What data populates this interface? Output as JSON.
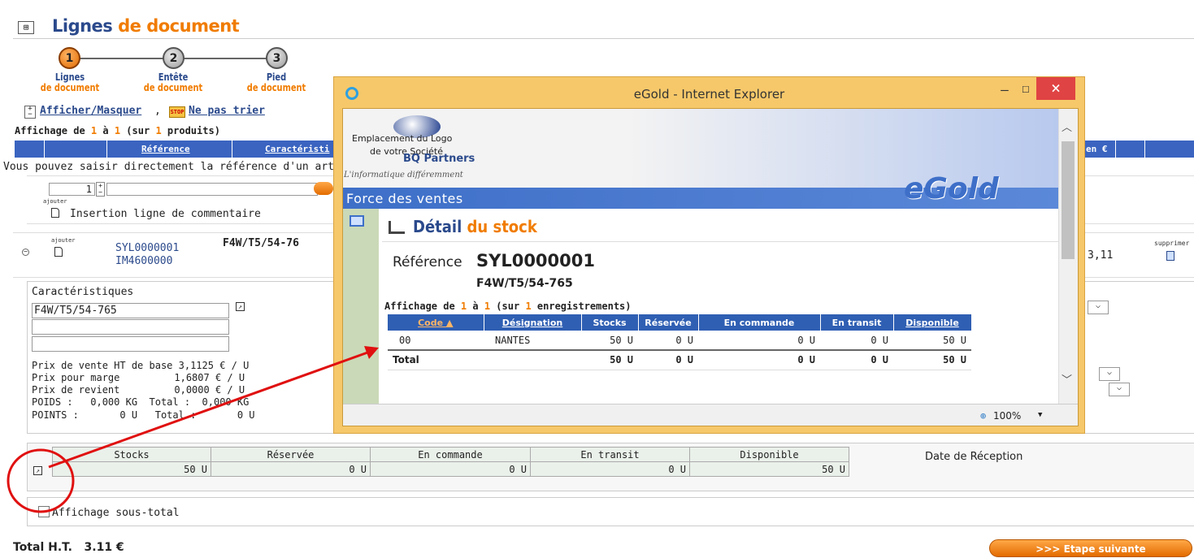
{
  "page": {
    "title_part1": "Lignes",
    "title_part2": "de document",
    "steps": [
      {
        "num": "1",
        "line1": "Lignes",
        "line2": "de document"
      },
      {
        "num": "2",
        "line1": "Entête",
        "line2": "de document"
      },
      {
        "num": "3",
        "line1": "Pied",
        "line2": "de document"
      }
    ],
    "toggle_link": "Afficher/Masquer",
    "comma": ",",
    "nosort_link": "Ne pas trier",
    "stop_label": "STOP",
    "display_prefix": "Affichage de ",
    "display_from": "1",
    "display_a": " à ",
    "display_to": "1",
    "display_sur": " (sur ",
    "display_total": "1",
    "display_suffix": " produits)",
    "col_reference": "Référence",
    "col_caracteristique": "Caractéristi",
    "col_en_euro": "en €",
    "hint_text": "Vous pouvez saisir directement la référence d'un artic",
    "qty_value": "1",
    "ref_input_value": "",
    "ajouter_label": "ajouter",
    "insert_comment": "Insertion ligne de commentaire",
    "row_ref1": "SYL0000001",
    "row_ref2": "IM4600000",
    "row_carac": "F4W/T5/54-76",
    "row_amount": "3,11",
    "supprimer_label": "supprimer",
    "carac_label": "Caractéristiques",
    "carac_values": [
      "F4W/T5/54-765",
      "",
      ""
    ],
    "prices": [
      {
        "label": "Prix de vente HT de base",
        "value": "3,1125 € / U"
      },
      {
        "label": "Prix pour marge",
        "value": "1,6807 € / U"
      },
      {
        "label": "Prix de revient",
        "value": "0,0000 € / U"
      }
    ],
    "poids_line": "POIDS :   0,000 KG  Total :  0,000 KG",
    "points_line": "POINTS :       0 U   Total :       0 U",
    "stock_headers": [
      "Stocks",
      "Réservée",
      "En commande",
      "En transit",
      "Disponible"
    ],
    "stock_values": [
      "50 U",
      "0 U",
      "0 U",
      "0 U",
      "50 U"
    ],
    "date_reception": "Date de Réception",
    "subtotal_label": "Affichage sous-total",
    "total_ht": "Total H.T.   3.11 €",
    "next_button": ">>> Etape suivante"
  },
  "popup": {
    "window_title": "eGold - Internet Explorer",
    "logo_text1": "Emplacement du Logo",
    "logo_text2": "de votre Société",
    "bq_text": "BQ Partners",
    "tagline": "L'informatique différemment",
    "banner": "Force des ventes",
    "egold": "eGold",
    "detail_title1": "Détail",
    "detail_title2": "du stock",
    "ref_label": "Référence",
    "ref_value": "SYL0000001",
    "ref_sub": "F4W/T5/54-765",
    "disp_prefix": "Affichage de ",
    "disp_from": "1",
    "disp_a": " à ",
    "disp_to": "1",
    "disp_sur": " (sur ",
    "disp_total": "1",
    "disp_suffix": " enregistrements)",
    "columns": [
      "Code ▲",
      "Désignation",
      "Stocks",
      "Réservée",
      "En commande",
      "En transit",
      "Disponible"
    ],
    "rows": [
      [
        "00",
        "NANTES",
        "50 U",
        "0 U",
        "0 U",
        "0 U",
        "50 U"
      ]
    ],
    "total_row": [
      "Total",
      "",
      "50 U",
      "0 U",
      "0 U",
      "0 U",
      "50 U"
    ],
    "zoom": "100%",
    "minimize": "–",
    "maximize": "☐",
    "close": "×"
  },
  "colors": {
    "accent": "#f07c00",
    "brand": "#2b4a8c",
    "header_blue": "#3a64c0",
    "annotation": "#e01010"
  }
}
